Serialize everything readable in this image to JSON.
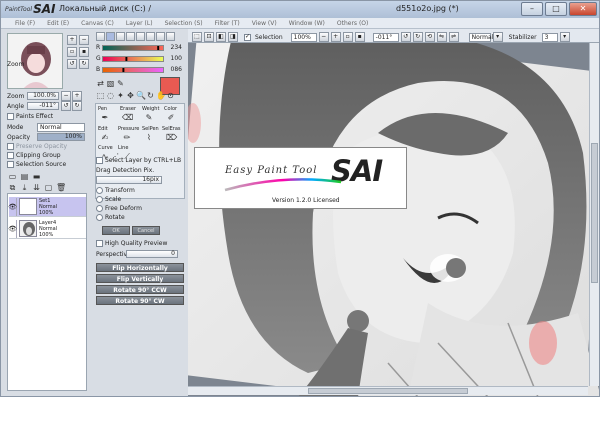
{
  "app": {
    "logo_small": "PaintTool",
    "logo_big": "SAI",
    "title_path": "Локальный диск (C:) /",
    "title_file": "d551o2o.jpg (*)",
    "window_buttons": {
      "minimize": "–",
      "maximize": "□",
      "close": "✕"
    }
  },
  "menu": [
    "File (F)",
    "Edit (E)",
    "Canvas (C)",
    "Layer (L)",
    "Selection (S)",
    "Filter (T)",
    "View (V)",
    "Window (W)",
    "Others (O)"
  ],
  "navigator": {
    "zoom_label": "Zoom",
    "zoom_value": "100.0%",
    "angle_label": "Angle",
    "angle_value": "-011°"
  },
  "layer_panel": {
    "paints_effect": "Paints Effect",
    "mode_label": "Mode",
    "mode_value": "Normal",
    "opacity_label": "Opacity",
    "opacity_value": "100%",
    "preserve_opacity": "Preserve Opacity",
    "clipping_group": "Clipping Group",
    "selection_source": "Selection Source",
    "layers": [
      {
        "name": "Set1",
        "mode": "Normal",
        "opacity": "100%"
      },
      {
        "name": "Layer4",
        "mode": "Normal",
        "opacity": "100%"
      }
    ]
  },
  "color": {
    "r_label": "R",
    "r_value": "234",
    "r_fraction": 0.92,
    "g_label": "G",
    "g_value": "100",
    "g_fraction": 0.39,
    "b_label": "B",
    "b_value": "086",
    "b_fraction": 0.34,
    "current": "#e85a52"
  },
  "tools": {
    "row1": [
      "Pen",
      "Eraser",
      "Weight",
      "Color"
    ],
    "row2": [
      "Edit",
      "Pressure",
      "SelPen",
      "SelEras"
    ],
    "row3": [
      "Curve",
      "Line"
    ]
  },
  "tool_options": {
    "select_layer_ctrl": "Select Layer by CTRL+LB",
    "drag_detection": "Drag Detection Pix.",
    "drag_value": "16pix",
    "transform": "Transform",
    "scale": "Scale",
    "free_deform": "Free Deform",
    "rotate": "Rotate",
    "ok": "OK",
    "cancel": "Cancel",
    "high_quality": "High Quality Preview",
    "perspective_label": "Perspective",
    "perspective_value": "0",
    "flip_h": "Flip Horizontally",
    "flip_v": "Flip Vertically",
    "rot_ccw": "Rotate 90° CCW",
    "rot_cw": "Rotate 90° CW"
  },
  "canvas_toolbar": {
    "selection": "Selection",
    "zoom": "100%",
    "angle": "-011°",
    "mode": "Normal",
    "stabilizer_label": "Stabilizer",
    "stabilizer_value": "3"
  },
  "splash": {
    "tagline": "Easy Paint Tool",
    "name": "SAI",
    "version": "Version 1.2.0  Licensed"
  }
}
